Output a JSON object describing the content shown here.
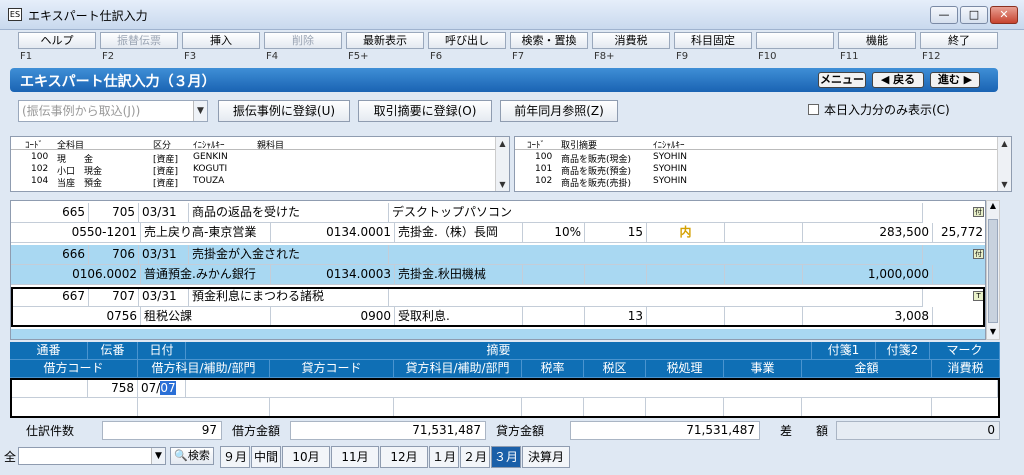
{
  "window": {
    "title": "エキスパート仕訳入力",
    "icon": "window-app-icon"
  },
  "fkeys": [
    {
      "label": "ヘルプ",
      "key": "F1",
      "enabled": true
    },
    {
      "label": "振替伝票",
      "key": "F2",
      "enabled": false
    },
    {
      "label": "挿入",
      "key": "F3",
      "enabled": true
    },
    {
      "label": "削除",
      "key": "F4",
      "enabled": false
    },
    {
      "label": "最新表示",
      "key": "F5+",
      "enabled": true
    },
    {
      "label": "呼び出し",
      "key": "F6",
      "enabled": true
    },
    {
      "label": "検索・置換",
      "key": "F7",
      "enabled": true
    },
    {
      "label": "消費税",
      "key": "F8+",
      "enabled": true
    },
    {
      "label": "科目固定",
      "key": "F9",
      "enabled": true
    },
    {
      "label": "",
      "key": "F10",
      "enabled": true
    },
    {
      "label": "機能",
      "key": "F11",
      "enabled": true
    },
    {
      "label": "終了",
      "key": "F12",
      "enabled": true
    }
  ],
  "banner": {
    "title": "エキスパート仕訳入力（３月）",
    "menu": "メニュー",
    "back": "◀ 戻る",
    "forward": "進む ▶"
  },
  "toolbar": {
    "combo_placeholder": "(振伝事例から取込(J))",
    "register_case": "振伝事例に登録(U)",
    "register_summary": "取引摘要に登録(O)",
    "prev_year": "前年同月参照(Z)",
    "today_only": "本日入力分のみ表示(C)"
  },
  "account_list": {
    "headers": [
      "ｺｰﾄﾞ",
      "全科目",
      "区分",
      "ｲﾆｼｬﾙｷｰ",
      "親科目"
    ],
    "rows": [
      [
        "100",
        "現　　金",
        "[資産]",
        "GENKIN"
      ],
      [
        "102",
        "小口　現金",
        "[資産]",
        "KOGUTI"
      ],
      [
        "104",
        "当座　預金",
        "[資産]",
        "TOUZA"
      ]
    ]
  },
  "summary_list": {
    "headers": [
      "ｺｰﾄﾞ",
      "取引摘要",
      "ｲﾆｼｬﾙｷｰ"
    ],
    "rows": [
      [
        "100",
        "商品を販売(現金)",
        "SYOHIN"
      ],
      [
        "101",
        "商品を販売(預金)",
        "SYOHIN"
      ],
      [
        "102",
        "商品を販売(売掛)",
        "SYOHIN"
      ]
    ]
  },
  "entries": [
    {
      "no": "665",
      "slip": "705",
      "date": "03/31",
      "summary": "商品の返品を受けた",
      "summary2": "デスクトップパソコン",
      "debit_code": "0550-1201",
      "debit_name": "売上戻り高-東京営業",
      "credit_code": "0134.0001",
      "credit_name": "売掛金.（株）長岡",
      "tax_rate": "10%",
      "tax_cat": "15",
      "tax_proc": "内",
      "amount": "283,500",
      "tax": "25,772",
      "memo": "付",
      "highlight": false
    },
    {
      "no": "666",
      "slip": "706",
      "date": "03/31",
      "summary": "売掛金が入金された",
      "summary2": "",
      "debit_code": "0106.0002",
      "debit_name": "普通預金.みかん銀行",
      "credit_code": "0134.0003",
      "credit_name": "売掛金.秋田機械",
      "tax_rate": "",
      "tax_cat": "",
      "tax_proc": "",
      "amount": "1,000,000",
      "tax": "",
      "memo": "付",
      "highlight": true
    },
    {
      "no": "667",
      "slip": "707",
      "date": "03/31",
      "summary": "預金利息にまつわる諸税",
      "summary2": "",
      "debit_code": "0756",
      "debit_name": "租税公課",
      "credit_code": "0900",
      "credit_name": "受取利息.",
      "tax_rate": "",
      "tax_cat": "13",
      "tax_proc": "",
      "amount": "3,008",
      "tax": "",
      "memo": "T",
      "highlight": false
    }
  ],
  "header": {
    "row1": [
      "通番",
      "伝番",
      "日付",
      "摘要",
      "付箋1",
      "付箋2",
      "マーク"
    ],
    "row2": [
      "借方コード",
      "借方科目/補助/部門",
      "貸方コード",
      "貸方科目/補助/部門",
      "税率",
      "税区",
      "税処理",
      "事業",
      "金額",
      "消費税"
    ]
  },
  "input": {
    "slip": "758",
    "date_prefix": "07/",
    "date_sel": "07"
  },
  "totals": {
    "count_label": "仕訳件数",
    "count": "97",
    "debit_label": "借方金額",
    "debit": "71,531,487",
    "credit_label": "貸方金額",
    "credit": "71,531,487",
    "diff_label": "差　　額",
    "diff": "0"
  },
  "bottom": {
    "label": "全",
    "search": "検索",
    "tabs": [
      "９月",
      "中間",
      "10月",
      "11月",
      "12月",
      "１月",
      "２月",
      "３月",
      "決算月"
    ],
    "active": "３月"
  }
}
